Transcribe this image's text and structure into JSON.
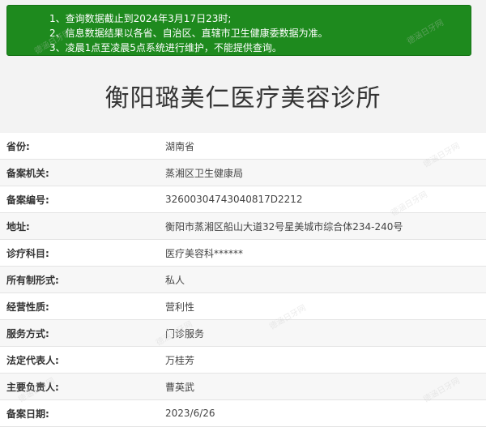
{
  "notice": {
    "lines": [
      "1、查询数据截止到2024年3月17日23时;",
      "2、信息数据结果以各省、自治区、直辖市卫生健康委数据为准。",
      "3、凌晨1点至凌晨5点系统进行维护，不能提供查询。"
    ]
  },
  "title": "衡阳璐美仁医疗美容诊所",
  "rows": [
    {
      "label": "省份:",
      "value": "湖南省"
    },
    {
      "label": "备案机关:",
      "value": "蒸湘区卫生健康局"
    },
    {
      "label": "备案编号:",
      "value": "32600304743040817D2212"
    },
    {
      "label": "地址:",
      "value": "衡阳市蒸湘区船山大道32号星美城市综合体234-240号"
    },
    {
      "label": "诊疗科目:",
      "value": "医疗美容科******"
    },
    {
      "label": "所有制形式:",
      "value": "私人"
    },
    {
      "label": "经营性质:",
      "value": "营利性"
    },
    {
      "label": "服务方式:",
      "value": "门诊服务"
    },
    {
      "label": "法定代表人:",
      "value": "万桂芳"
    },
    {
      "label": "主要负责人:",
      "value": "曹英武"
    },
    {
      "label": "备案日期:",
      "value": "2023/6/26"
    }
  ],
  "watermark": "德涵日牙网"
}
